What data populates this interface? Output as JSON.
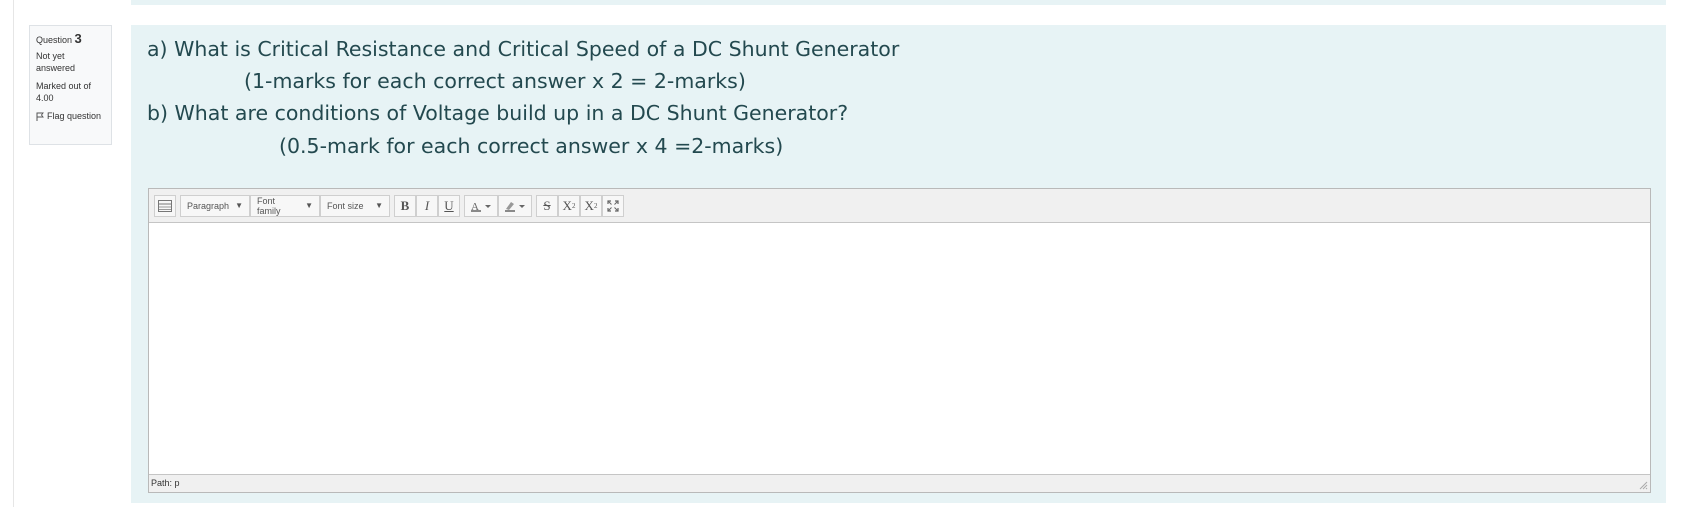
{
  "question_info": {
    "label": "Question",
    "number": "3",
    "state": "Not yet answered",
    "grade": "Marked out of 4.00",
    "flag_label": "Flag question",
    "flag_icon": "flag-icon"
  },
  "question_text": {
    "line_a": "a) What is Critical Resistance and Critical Speed of a DC Shunt Generator",
    "line_a_marks": "(1-marks for each correct answer x 2 = 2-marks)",
    "line_b": "b) What are conditions of Voltage build up in a DC Shunt Generator?",
    "line_b_marks": "(0.5-mark for each correct answer x 4 =2-marks)"
  },
  "editor": {
    "toolbar_toggle_icon": "kitchen-sink-icon",
    "format_select": "Paragraph",
    "font_family_select": "Font family",
    "font_size_select": "Font size",
    "bold": "B",
    "italic": "I",
    "underline": "U",
    "text_color_icon": "text-color-icon",
    "background_color_icon": "background-color-icon",
    "strikethrough": "S",
    "subscript_base": "X",
    "subscript_mark": "2",
    "superscript_base": "X",
    "superscript_mark": "2",
    "fullscreen_icon": "fullscreen-icon",
    "path_label": "Path: p",
    "resize_icon": "resize-handle-icon"
  }
}
